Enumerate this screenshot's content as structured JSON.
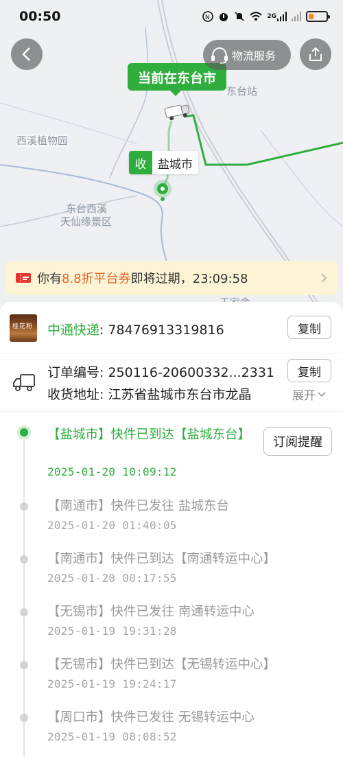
{
  "status_bar": {
    "time": "00:50",
    "icons": [
      "nfc-icon",
      "alarm-icon",
      "mute-icon",
      "wifi-icon",
      "signal-icon",
      "signal-icon-2",
      "battery-icon"
    ],
    "network_label": "2G"
  },
  "map": {
    "current_location": "当前在东台市",
    "receiver_tag": {
      "key": "收",
      "value": "盐城市"
    },
    "labels": {
      "station": "东台站",
      "garden": "西溪植物园",
      "scenic_line1": "东台西溪",
      "scenic_line2": "天仙缘景区",
      "partial": "王家舍"
    },
    "route_color": "#2fae3d"
  },
  "header": {
    "service_label": "物流服务"
  },
  "coupon": {
    "prefix": "你有",
    "highlight": "8.8折平台券",
    "suffix": "即将过期，23:09:58",
    "highlight_color": "#e0652b"
  },
  "package": {
    "carrier_name": "中通快递",
    "tracking_sep": ": ",
    "tracking_number": "78476913319816",
    "copy_label": "复制",
    "order_label": "订单编号: ",
    "order_number": "250116-20600332...2331",
    "order_copy_label": "复制",
    "address_label": "收货地址: ",
    "address": "江苏省盐城市东台市龙晶",
    "expand_label": "展开"
  },
  "timeline": {
    "subscribe_label": "订阅提醒",
    "events": [
      {
        "status": "【盐城市】快件已到达【盐城东台】",
        "time": "2025-01-20 10:09:12"
      },
      {
        "status": "【南通市】快件已发往 盐城东台",
        "time": "2025-01-20 01:40:05"
      },
      {
        "status": "【南通市】快件已到达【南通转运中心】",
        "time": "2025-01-20 00:17:55"
      },
      {
        "status": "【无锡市】快件已发往 南通转运中心",
        "time": "2025-01-19 19:31:28"
      },
      {
        "status": "【无锡市】快件已到达【无锡转运中心】",
        "time": "2025-01-19 19:24:17"
      },
      {
        "status": "【周口市】快件已发往 无锡转运中心",
        "time": "2025-01-19 08:08:52"
      }
    ]
  }
}
